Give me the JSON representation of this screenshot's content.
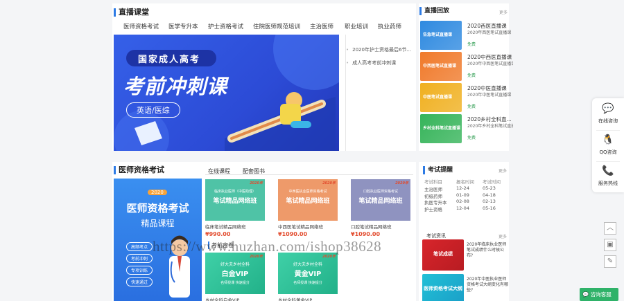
{
  "live_section": {
    "title": "直播课堂",
    "tabs": [
      "医师资格考试",
      "医学专升本",
      "护士资格考试",
      "住院医师规范培训",
      "主治医师",
      "职业培训",
      "执业药师"
    ],
    "banner": {
      "line1": "国家成人高考",
      "line2": "考前冲刺课",
      "line3": "英语/医综"
    },
    "news": [
      "2020年护士资格最后6节...",
      "成人高考考前冲刺课"
    ]
  },
  "replay_section": {
    "title": "直播回放",
    "more": "更多",
    "items": [
      {
        "thumb": "告急笔试直播课",
        "title": "2020西医直播课",
        "subtitle": "2020年西医笔试直播课",
        "free": "免费",
        "color": "#2f8ae0"
      },
      {
        "thumb": "中西医笔试直播课",
        "title": "2020中西医直播课",
        "subtitle": "2020年中西医笔试直播课",
        "free": "免费",
        "color": "#f07a2b"
      },
      {
        "thumb": "中医笔试直播课",
        "title": "2020中医直播课",
        "subtitle": "2020年中医笔试直播课",
        "free": "免费",
        "color": "#f0b020"
      },
      {
        "thumb": "乡村全科笔试直播课",
        "title": "2020乡村全科直...",
        "subtitle": "2020年乡村全科笔试直播课",
        "free": "免费",
        "color": "#36b45a"
      }
    ]
  },
  "exam_section": {
    "title": "医师资格考试",
    "tabs": [
      "在线课程",
      "配套图书"
    ],
    "promo": {
      "year": "2020",
      "line1": "医师资格考试",
      "line2": "精品课程",
      "pills": [
        "高频考点",
        "考前冲刺",
        "专项训练",
        "快速通过"
      ]
    },
    "courses": [
      {
        "img_title": "笔试精品网络班",
        "img_top": "临床执业医师（中医助理）",
        "name": "临床笔试精品网络班",
        "price": "¥990.00",
        "badge": "2020年",
        "bg": "#4fc3a6"
      },
      {
        "img_title": "笔试精品网络班",
        "img_top": "中西医执业医师资格考试",
        "name": "中西医笔试精品网络班",
        "price": "¥1090.00",
        "badge": "2020年",
        "bg": "#ee9a6a"
      },
      {
        "img_title": "笔试精品网络班",
        "img_top": "口腔执业医师资格考试",
        "name": "口腔笔试精品网络班",
        "price": "¥1090.00",
        "badge": "2020年",
        "bg": "#8f93c0"
      }
    ],
    "vip_label": "考前密卷",
    "vip": [
      {
        "top": "好大夫乡村全科",
        "title": "白金VIP",
        "sub": "名师授课  快速提分",
        "name": "乡村全科白金VIP",
        "badge": "2020年"
      },
      {
        "top": "好大夫乡村全科",
        "title": "黄金VIP",
        "sub": "名师授课  快速提分",
        "name": "乡村全科黄金VIP",
        "badge": "2020年"
      }
    ]
  },
  "reminder": {
    "title": "考试提醒",
    "more": "更多",
    "headers": [
      "考试科目",
      "报名时间",
      "考试时间"
    ],
    "rows": [
      [
        "主治医师",
        "12-24",
        "05-23"
      ],
      [
        "初级药师",
        "01-09",
        "04-18"
      ],
      [
        "执医专升本",
        "02-08",
        "02-13"
      ],
      [
        "护士资格",
        "12-04",
        "05-16"
      ]
    ]
  },
  "news_block": {
    "title": "考试资讯",
    "more": "更多",
    "items": [
      {
        "thumb": "笔试成绩",
        "text": "2020年临床执业医师笔试成绩什么时候公布?"
      },
      {
        "thumb": "医师资格考试大纲",
        "text": "2020年中医执业医师资格考试大纲变化有哪些?"
      }
    ]
  },
  "sidebar": {
    "buttons": [
      "在线咨询",
      "QQ咨询",
      "服务热线"
    ],
    "tools": [
      "top",
      "qrcode",
      "edit"
    ],
    "chat": "咨询客服"
  },
  "watermark": "https://www.huzhan.com/ishop38628"
}
